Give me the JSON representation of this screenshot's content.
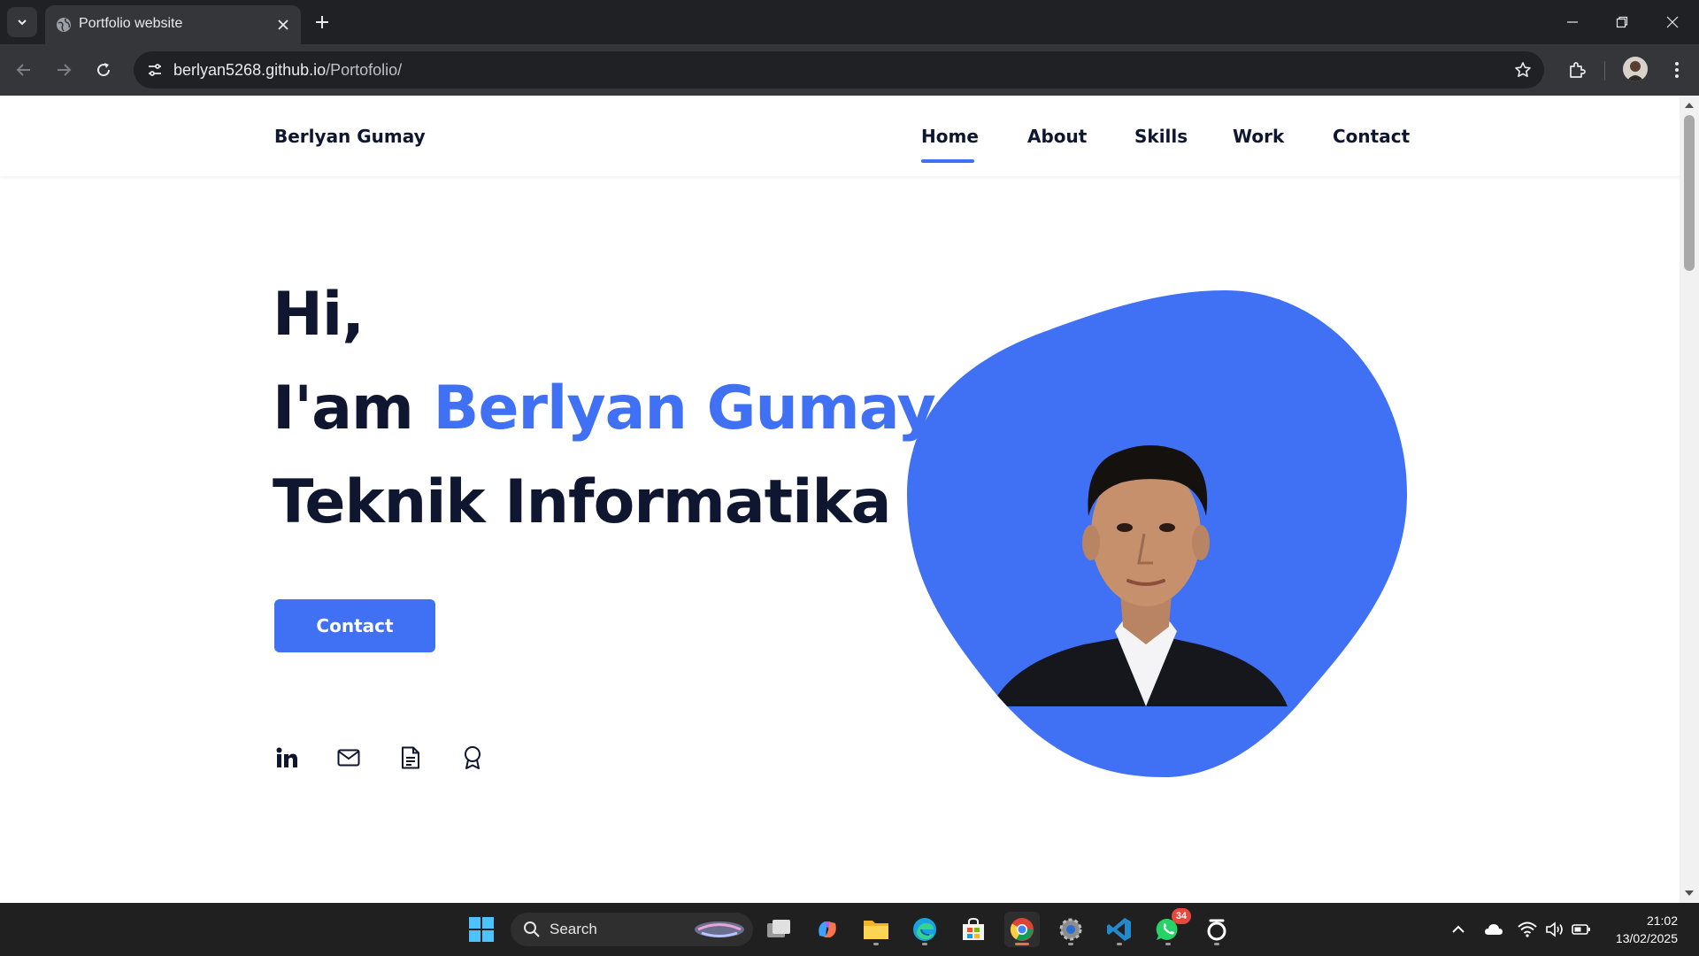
{
  "browser": {
    "tab_title": "Portfolio website",
    "url_host": "berlyan5268.github.io",
    "url_path": "/Portofolio/"
  },
  "site": {
    "logo": "Berlyan Gumay",
    "nav": [
      {
        "label": "Home",
        "active": true
      },
      {
        "label": "About",
        "active": false
      },
      {
        "label": "Skills",
        "active": false
      },
      {
        "label": "Work",
        "active": false
      },
      {
        "label": "Contact",
        "active": false
      }
    ],
    "hero": {
      "line1": "Hi,",
      "line2_prefix": "I'am ",
      "line2_name": "Berlyan Gumay",
      "line3": "Teknik Informatika",
      "button": "Contact"
    },
    "social_icons": [
      "linkedin-icon",
      "mail-icon",
      "document-icon",
      "award-icon"
    ],
    "colors": {
      "accent": "#4070f4",
      "heading": "#0e1630"
    }
  },
  "taskbar": {
    "search_label": "Search",
    "whatsapp_badge": "34",
    "time": "21:02",
    "date": "13/02/2025"
  }
}
